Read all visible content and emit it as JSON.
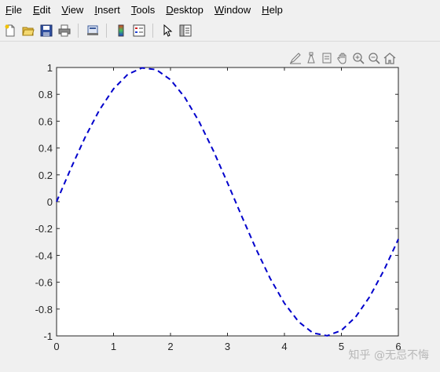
{
  "menu": [
    {
      "first": "F",
      "rest": "ile"
    },
    {
      "first": "E",
      "rest": "dit"
    },
    {
      "first": "V",
      "rest": "iew"
    },
    {
      "first": "I",
      "rest": "nsert"
    },
    {
      "first": "T",
      "rest": "ools"
    },
    {
      "first": "D",
      "rest": "esktop"
    },
    {
      "first": "W",
      "rest": "indow"
    },
    {
      "first": "H",
      "rest": "elp"
    }
  ],
  "toolbar": {
    "icons": [
      "new-figure-icon",
      "open-file-icon",
      "save-icon",
      "print-icon",
      "print-preview-icon",
      "colorbar-icon",
      "legend-icon",
      "pointer-icon",
      "property-inspector-icon"
    ]
  },
  "axes_toolbar": {
    "icons": [
      "brush-icon",
      "data-cursor-icon",
      "linked-plot-icon",
      "pan-icon",
      "zoom-in-icon",
      "zoom-out-icon",
      "home-icon"
    ]
  },
  "watermark": "知乎 @无忌不悔",
  "chart_data": {
    "type": "line",
    "function": "sin(x)",
    "x": [
      0,
      0.25,
      0.5,
      0.75,
      1,
      1.25,
      1.5,
      1.75,
      2,
      2.25,
      2.5,
      2.75,
      3,
      3.25,
      3.5,
      3.75,
      4,
      4.25,
      4.5,
      4.75,
      5,
      5.25,
      5.5,
      5.75,
      6
    ],
    "series": [
      {
        "values": [
          0,
          0.247,
          0.479,
          0.682,
          0.841,
          0.949,
          0.997,
          0.984,
          0.909,
          0.778,
          0.598,
          0.382,
          0.141,
          -0.108,
          -0.351,
          -0.572,
          -0.757,
          -0.895,
          -0.978,
          -0.999,
          -0.959,
          -0.859,
          -0.706,
          -0.508,
          -0.279
        ],
        "color": "#0000cc",
        "style": "dashed"
      }
    ],
    "xlim": [
      0,
      6
    ],
    "ylim": [
      -1,
      1
    ],
    "xticks": [
      "0",
      "1",
      "2",
      "3",
      "4",
      "5",
      "6"
    ],
    "yticks": [
      "-1",
      "-0.8",
      "-0.6",
      "-0.4",
      "-0.2",
      "0",
      "0.2",
      "0.4",
      "0.6",
      "0.8",
      "1"
    ],
    "grid": false,
    "title": "",
    "xlabel": "",
    "ylabel": ""
  }
}
